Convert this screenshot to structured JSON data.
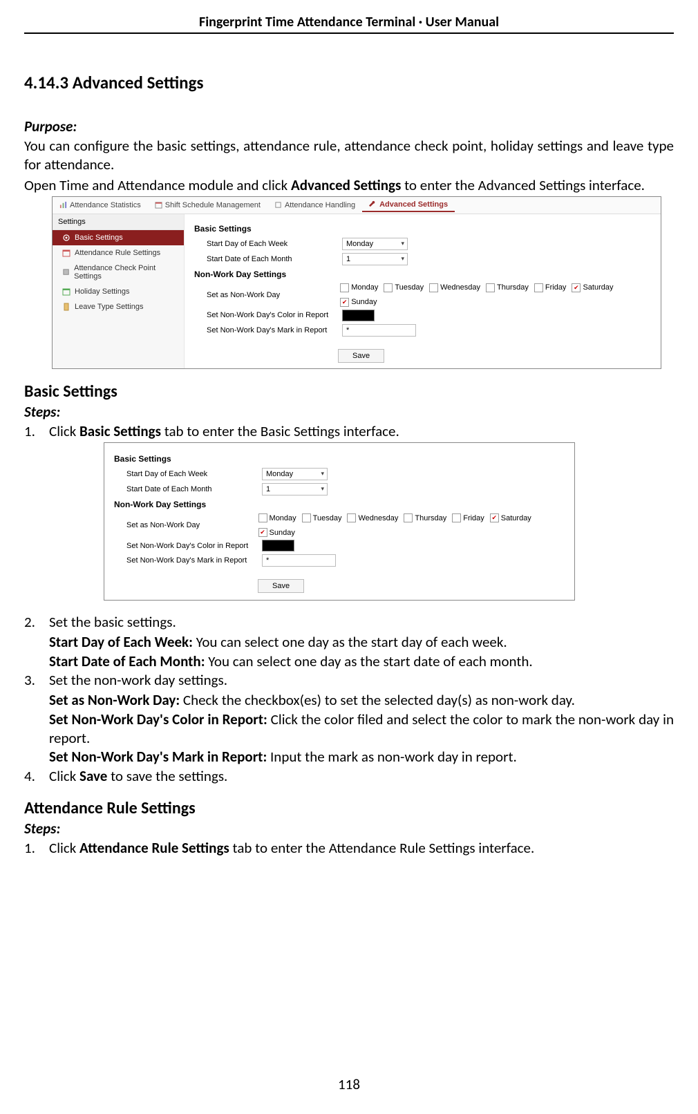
{
  "header": "Fingerprint Time Attendance Terminal · User Manual",
  "section": {
    "number_title": "4.14.3 Advanced Settings",
    "purpose_label": "Purpose:",
    "purpose_text": "You can configure the basic settings, attendance rule, attendance check point, holiday settings and leave type for attendance.",
    "open_text_1": "Open Time and Attendance module and click ",
    "open_text_bold": "Advanced Settings",
    "open_text_2": " to enter the Advanced Settings interface."
  },
  "app": {
    "tabs": [
      "Attendance Statistics",
      "Shift Schedule Management",
      "Attendance Handling",
      "Advanced Settings"
    ],
    "sidebar_title": "Settings",
    "sidebar": [
      "Basic Settings",
      "Attendance Rule Settings",
      "Attendance Check Point Settings",
      "Holiday Settings",
      "Leave Type Settings"
    ],
    "basic_title": "Basic Settings",
    "start_day_label": "Start Day of Each Week",
    "start_day_value": "Monday",
    "start_date_label": "Start Date of Each Month",
    "start_date_value": "1",
    "nonwork_title": "Non-Work Day Settings",
    "set_nonwork_label": "Set as Non-Work Day",
    "days": [
      "Monday",
      "Tuesday",
      "Wednesday",
      "Thursday",
      "Friday",
      "Saturday",
      "Sunday"
    ],
    "checked_days": [
      "Saturday",
      "Sunday"
    ],
    "color_label": "Set Non-Work Day's Color in Report",
    "mark_label": "Set Non-Work Day's Mark in Report",
    "mark_value": "*",
    "save": "Save"
  },
  "basic_settings_heading": "Basic Settings",
  "steps_label": "Steps:",
  "steps": {
    "s1": {
      "n": "1.",
      "pre": "Click ",
      "bold": "Basic Settings",
      "post": " tab to enter the Basic Settings interface."
    },
    "s2": {
      "n": "2.",
      "text": "Set the basic settings."
    },
    "s2a_bold": "Start Day of Each Week:",
    "s2a_rest": " You can select one day as the start day of each week.",
    "s2b_bold": "Start Date of Each Month:",
    "s2b_rest": " You can select one day as the start date of each month.",
    "s3": {
      "n": "3.",
      "text": "Set the non-work day settings."
    },
    "s3a_bold": "Set as Non-Work Day:",
    "s3a_rest": " Check the checkbox(es) to set the selected day(s) as non-work day.",
    "s3b_bold": "Set Non-Work Day's Color in Report:",
    "s3b_rest": " Click the color filed and select the color to mark the non-work day in report.",
    "s3c_bold": "Set Non-Work Day's Mark in Report:",
    "s3c_rest": " Input the mark as non-work day in report.",
    "s4": {
      "n": "4.",
      "pre": "Click ",
      "bold": "Save",
      "post": " to save the settings."
    }
  },
  "attendance_heading": "Attendance Rule Settings",
  "attendance_step1": {
    "n": "1.",
    "pre": "Click ",
    "bold": "Attendance Rule Settings",
    "post": " tab to enter the Attendance Rule Settings interface."
  },
  "page_number": "118"
}
